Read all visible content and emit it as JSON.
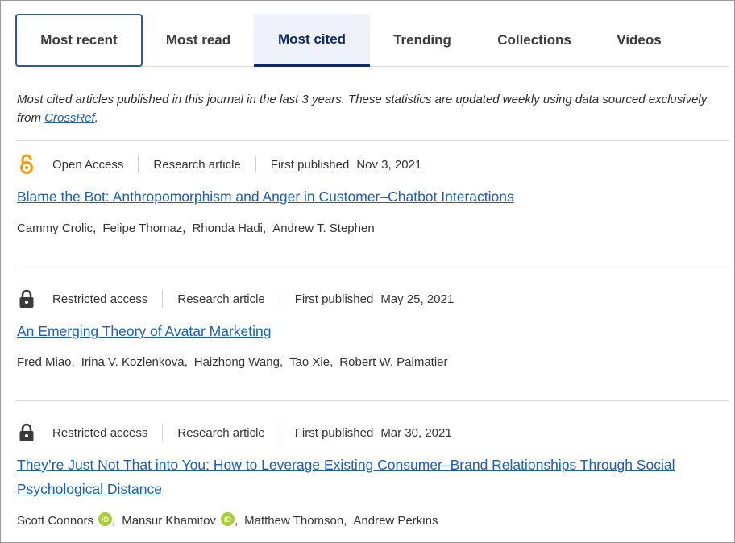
{
  "tabs": [
    {
      "label": "Most recent"
    },
    {
      "label": "Most read"
    },
    {
      "label": "Most cited"
    },
    {
      "label": "Trending"
    },
    {
      "label": "Collections"
    },
    {
      "label": "Videos"
    }
  ],
  "description": {
    "text": "Most cited articles published in this journal in the last 3 years. These statistics are updated weekly using data sourced exclusively from ",
    "link": "CrossRef",
    "suffix": "."
  },
  "articles": [
    {
      "access": "Open Access",
      "access_icon": "open-access-icon",
      "type": "Research article",
      "published_label": "First published",
      "date": "Nov 3, 2021",
      "title": "Blame the Bot: Anthropomorphism and Anger in Customer–Chatbot Interactions",
      "authors": [
        "Cammy Crolic",
        "Felipe Thomaz",
        "Rhonda Hadi",
        "Andrew T. Stephen"
      ]
    },
    {
      "access": "Restricted access",
      "access_icon": "lock-icon",
      "type": "Research article",
      "published_label": "First published",
      "date": "May 25, 2021",
      "title": "An Emerging Theory of Avatar Marketing",
      "authors": [
        "Fred Miao",
        "Irina V. Kozlenkova",
        "Haizhong Wang",
        "Tao Xie",
        "Robert W. Palmatier"
      ]
    },
    {
      "access": "Restricted access",
      "access_icon": "lock-icon",
      "type": "Research article",
      "published_label": "First published",
      "date": "Mar 30, 2021",
      "title_line1": "They’re Just Not That into You: How to Leverage Existing Consumer–Brand Relationships Through Social",
      "title_line2": "Psychological Distance",
      "authors": [
        "Scott Connors",
        "Mansur Khamitov",
        "Matthew Thomson",
        "Andrew Perkins"
      ],
      "orcid_badge": "iD"
    }
  ],
  "colors": {
    "link": "#1a5fb4",
    "active_tab": "#0f2a66",
    "open_access": "#f39c12",
    "orcid": "#a6ce39"
  }
}
